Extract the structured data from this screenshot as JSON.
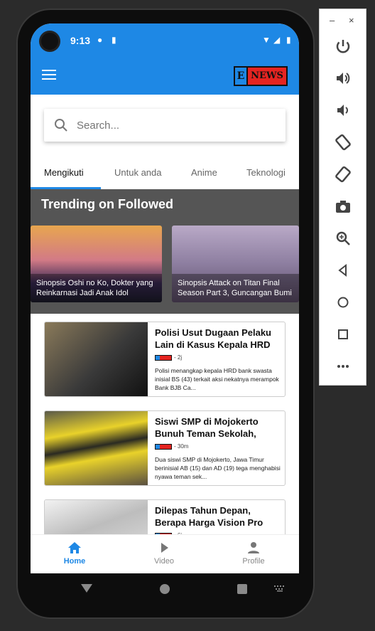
{
  "statusbar": {
    "time": "9:13"
  },
  "appbar": {
    "logo_e": "E",
    "logo_news": "NEWS"
  },
  "search": {
    "placeholder": "Search..."
  },
  "tabs": [
    {
      "label": "Mengikuti"
    },
    {
      "label": "Untuk anda"
    },
    {
      "label": "Anime"
    },
    {
      "label": "Teknologi"
    }
  ],
  "trending": {
    "heading": "Trending on Followed",
    "items": [
      {
        "caption": "Sinopsis Oshi no Ko, Dokter yang Reinkarnasi Jadi Anak Idol"
      },
      {
        "caption": "Sinopsis Attack on Titan Final Season Part 3, Guncangan Bumi"
      }
    ]
  },
  "feed": [
    {
      "title": "Polisi Usut Dugaan Pelaku Lain di Kasus Kepala HRD",
      "age": "- 2j",
      "desc": "Polisi menangkap kepala HRD bank swasta inisial BS (43) terkait aksi nekatnya merampok Bank BJB Ca..."
    },
    {
      "title": "Siswi SMP di Mojokerto Bunuh Teman Sekolah,",
      "age": "- 30m",
      "desc": "Dua siswi SMP di Mojokerto, Jawa Timur berinisial AB (15) dan AD (19) tega menghabisi nyawa teman sek..."
    },
    {
      "title": "Dilepas Tahun Depan, Berapa Harga Vision Pro",
      "age": "- 6j",
      "desc": ""
    }
  ],
  "bottomnav": [
    {
      "label": "Home",
      "icon": "home-icon"
    },
    {
      "label": "Video",
      "icon": "play-icon"
    },
    {
      "label": "Profile",
      "icon": "person-icon"
    }
  ],
  "colors": {
    "primary": "#1e88e5",
    "logo_red": "#e52421"
  }
}
